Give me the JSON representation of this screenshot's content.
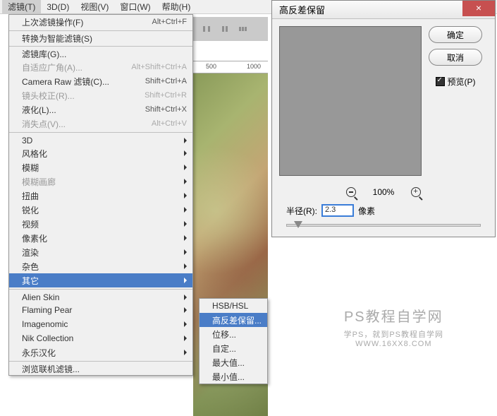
{
  "menubar": {
    "items": [
      "滤镜(T)",
      "3D(D)",
      "视图(V)",
      "窗口(W)",
      "帮助(H)"
    ]
  },
  "dropdown": {
    "last_filter": "上次滤镜操作(F)",
    "last_filter_shortcut": "Alt+Ctrl+F",
    "smart_filter": "转换为智能滤镜(S)",
    "filter_gallery": "滤镜库(G)...",
    "adaptive": "自适应广角(A)...",
    "adaptive_shortcut": "Alt+Shift+Ctrl+A",
    "camera_raw": "Camera Raw 滤镜(C)...",
    "camera_raw_shortcut": "Shift+Ctrl+A",
    "lens": "镜头校正(R)...",
    "lens_shortcut": "Shift+Ctrl+R",
    "liquify": "液化(L)...",
    "liquify_shortcut": "Shift+Ctrl+X",
    "vanishing": "消失点(V)...",
    "vanishing_shortcut": "Alt+Ctrl+V",
    "g3d": "3D",
    "stylize": "风格化",
    "blur": "模糊",
    "blur_gallery": "模糊画廊",
    "distort": "扭曲",
    "sharpen": "锐化",
    "video": "视频",
    "pixelate": "像素化",
    "render": "渲染",
    "noise": "杂色",
    "other": "其它",
    "alien_skin": "Alien Skin",
    "flaming_pear": "Flaming Pear",
    "imagenomic": "Imagenomic",
    "nik": "Nik Collection",
    "yongle": "永乐汉化",
    "browse": "浏览联机滤镜..."
  },
  "submenu": {
    "hsb": "HSB/HSL",
    "highpass": "高反差保留...",
    "offset": "位移...",
    "custom": "自定...",
    "max": "最大值...",
    "min": "最小值..."
  },
  "ruler": {
    "t1": "500",
    "t2": "1000"
  },
  "dialog": {
    "title": "高反差保留",
    "ok": "确定",
    "cancel": "取消",
    "preview": "预览(P)",
    "zoom": "100%",
    "radius_label": "半径(R):",
    "radius_value": "2.3",
    "radius_unit": "像素"
  },
  "watermark": {
    "big": "PS教程自学网",
    "line1": "学PS，就到PS教程自学网",
    "line2": "WWW.16XX8.COM"
  }
}
